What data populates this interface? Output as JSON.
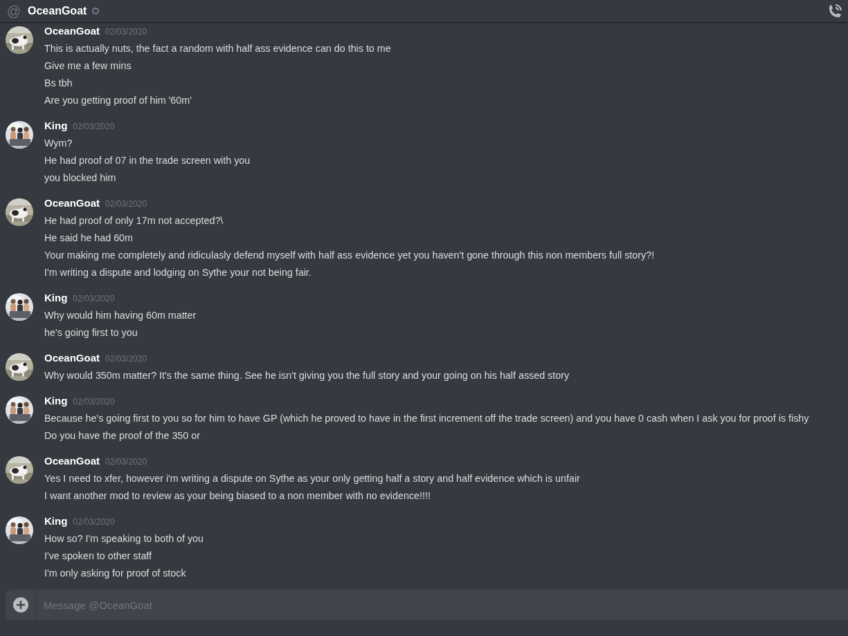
{
  "header": {
    "symbol": "@",
    "title": "OceanGoat",
    "online": false
  },
  "messages": [
    {
      "author": "OceanGoat",
      "time": "02/03/2020",
      "lines": [
        "This is actually nuts, the fact a random with half ass evidence can do this to me",
        "Give me a few mins",
        "Bs tbh",
        "Are you getting proof of him '60m'"
      ]
    },
    {
      "author": "King",
      "time": "02/03/2020",
      "lines": [
        "Wym?",
        "He had proof of 07 in the trade screen with you",
        "you blocked him"
      ]
    },
    {
      "author": "OceanGoat",
      "time": "02/03/2020",
      "lines": [
        "He had proof of only 17m not accepted?\\",
        "He said he had 60m",
        "Your making me completely and ridiculasly defend myself with half ass evidence yet you haven't gone through this non members full story?!",
        "I'm writing a dispute and lodging on Sythe your not being fair."
      ]
    },
    {
      "author": "King",
      "time": "02/03/2020",
      "lines": [
        "Why would him having 60m matter",
        "he's going first to you"
      ]
    },
    {
      "author": "OceanGoat",
      "time": "02/03/2020",
      "lines": [
        "Why would 350m matter? It's the same thing. See he isn't giving you the full story and your going on his half assed story"
      ]
    },
    {
      "author": "King",
      "time": "02/03/2020",
      "lines": [
        "Because he's going first to you so for him to have GP (which he proved to have in the first increment off the trade screen) and you have 0 cash when I ask you for proof is fishy",
        "Do you have the proof of the 350 or"
      ]
    },
    {
      "author": "OceanGoat",
      "time": "02/03/2020",
      "lines": [
        "Yes I need to xfer, however i'm writing a dispute on Sythe as your only getting half a story and half evidence which is unfair",
        "I want another mod to review as your being biased to a non member with no evidence!!!!"
      ]
    },
    {
      "author": "King",
      "time": "02/03/2020",
      "lines": [
        "How so? I'm speaking to both of you",
        "I've spoken to other staff",
        "I'm only asking for proof of stock"
      ]
    }
  ],
  "composer": {
    "placeholder": "Message @OceanGoat"
  }
}
